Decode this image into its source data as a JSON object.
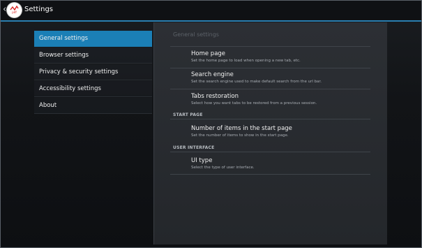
{
  "app": {
    "title": "Settings",
    "icon_name": "pdf-app-logo-icon",
    "accent_color": "#1b7fb6"
  },
  "nav": {
    "items": [
      {
        "label": "General settings",
        "selected": true
      },
      {
        "label": "Browser settings",
        "selected": false
      },
      {
        "label": "Privacy & security settings",
        "selected": false
      },
      {
        "label": "Accessibility settings",
        "selected": false
      },
      {
        "label": "About",
        "selected": false
      }
    ]
  },
  "panel": {
    "title": "General settings",
    "prefs": [
      {
        "title": "Home page",
        "summary": "Set the home page to load when opening a new tab, etc."
      },
      {
        "title": "Search engine",
        "summary": "Set the search engine used to make default search from the url bar."
      },
      {
        "title": "Tabs restoration",
        "summary": "Select how you want tabs to be restored from a previous session."
      }
    ],
    "start_page": {
      "header": "START PAGE",
      "prefs": [
        {
          "title": "Number of items in the start page",
          "summary": "Set the number of items to show in the start page."
        }
      ]
    },
    "user_interface": {
      "header": "USER INTERFACE",
      "prefs": [
        {
          "title": "UI type",
          "summary": "Select the type of user interface."
        }
      ]
    }
  }
}
